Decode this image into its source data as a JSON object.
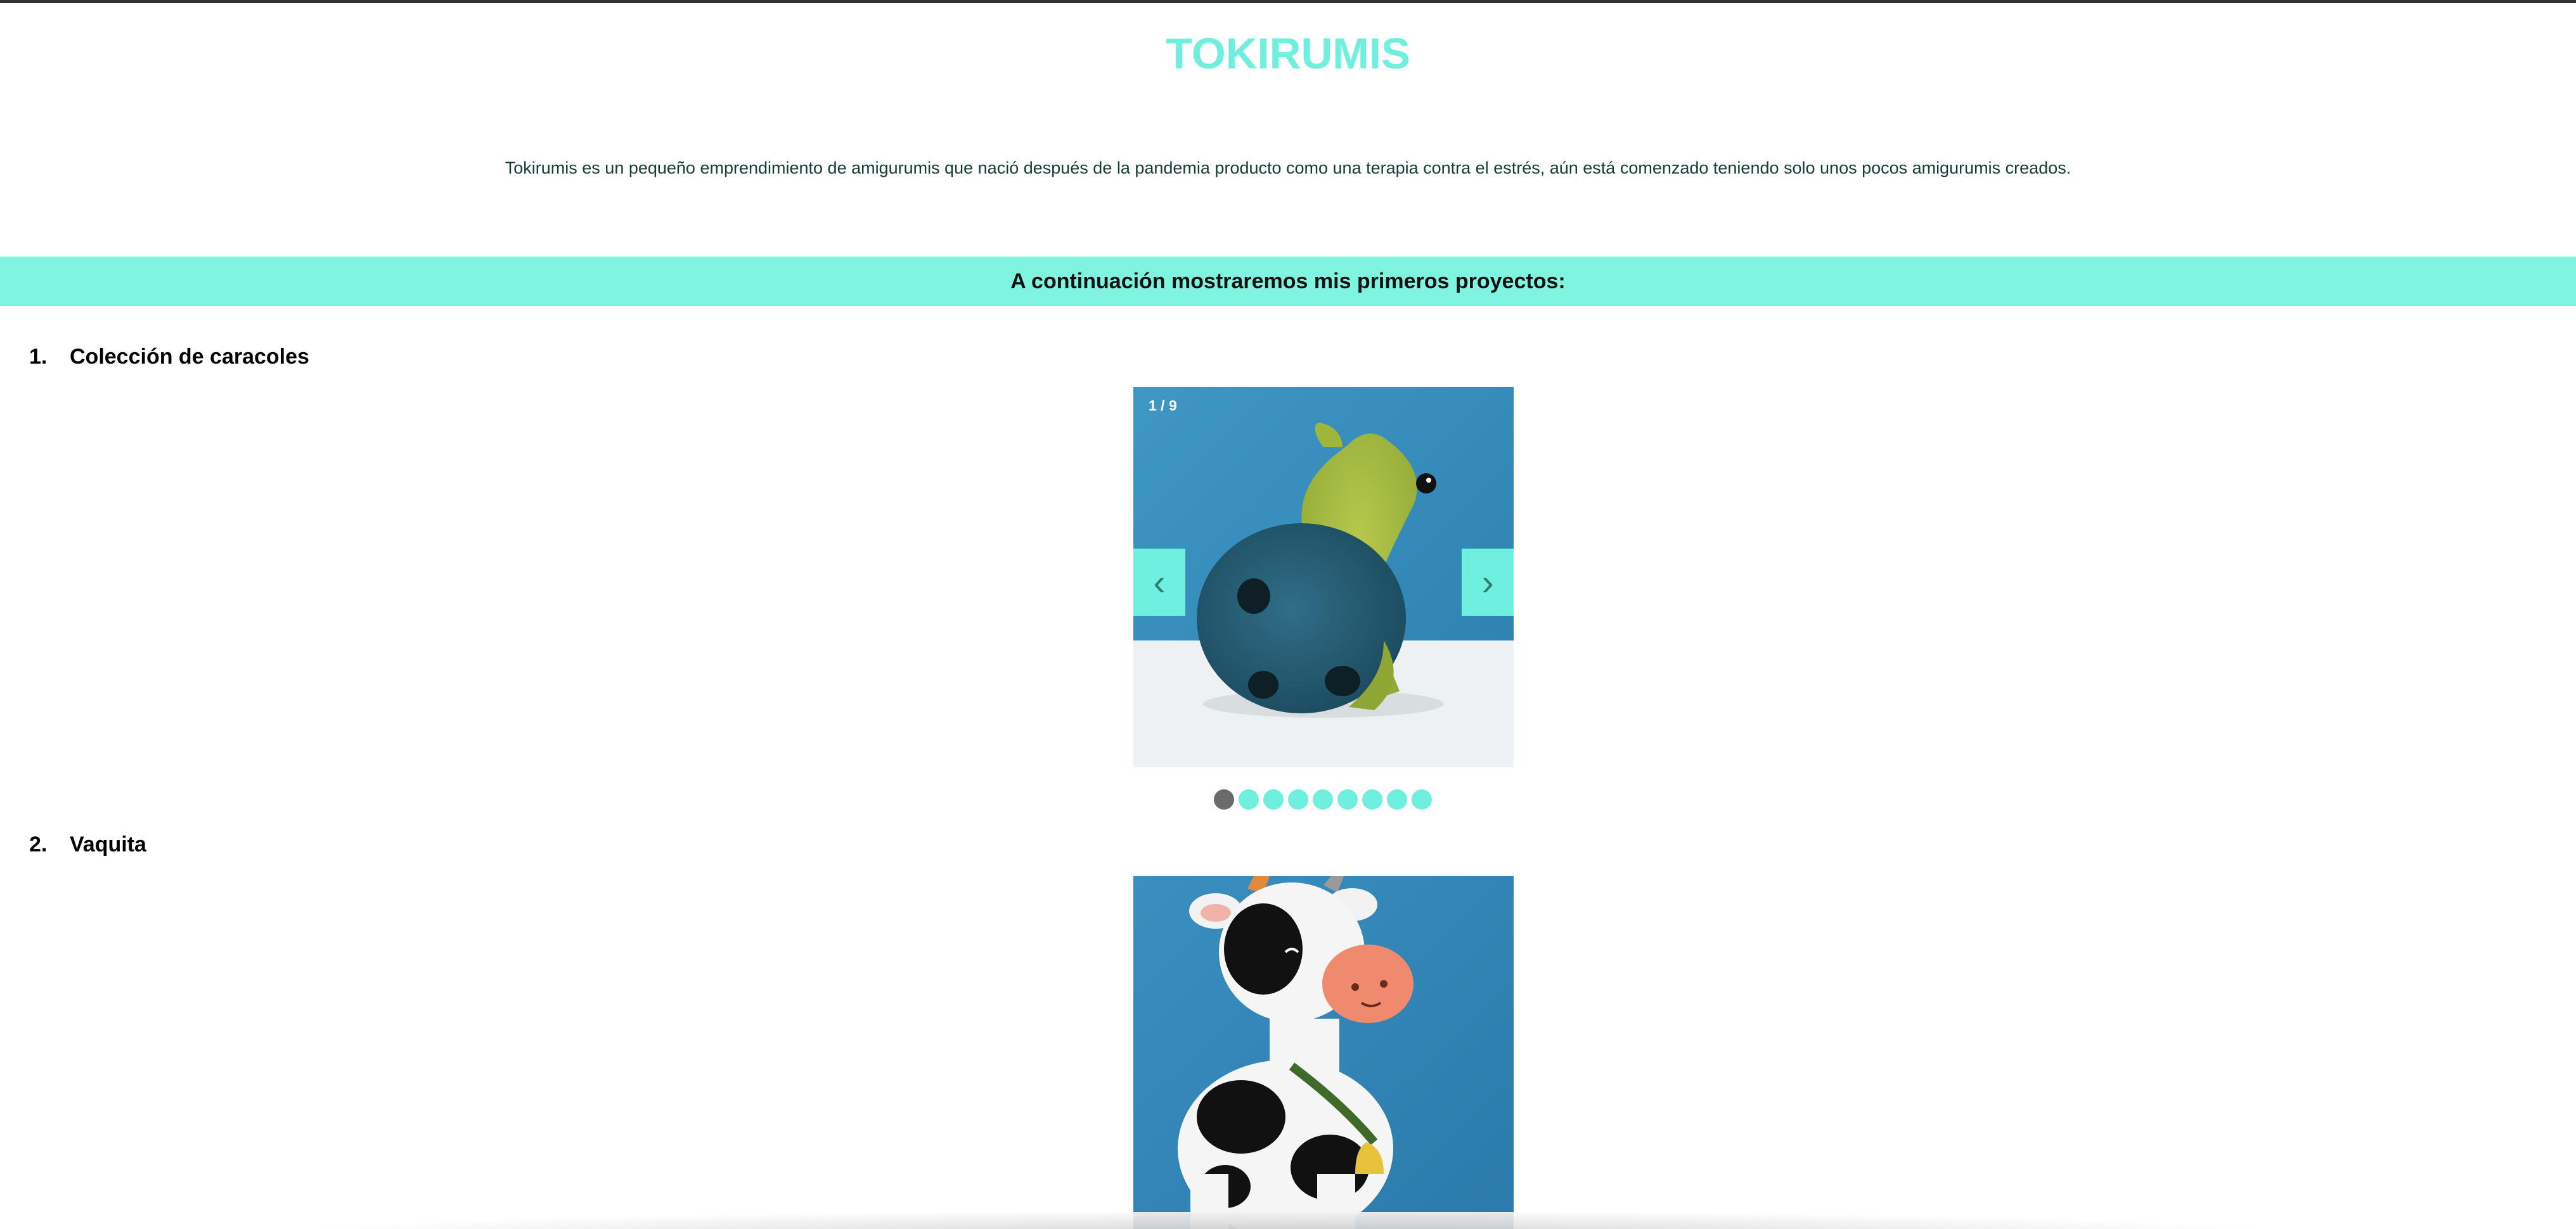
{
  "colors": {
    "accent": "#7ff5e1",
    "title": "#6ff0de",
    "nav_button": "#6ff0de",
    "dot_active": "#6b6b6b",
    "dot_inactive": "#6ff0de"
  },
  "header": {
    "title": "TOKIRUMIS",
    "intro": "Tokirumis es un pequeño emprendimiento de amigurumis que nació después de la pandemia producto como una terapia contra el estrés, aún está comenzado teniendo solo unos pocos amigurumis creados."
  },
  "banner": {
    "text": "A continuación mostraremos mis primeros proyectos:"
  },
  "projects": [
    {
      "number": "1.",
      "title": "Colección de caracoles",
      "carousel": {
        "counter": "1 / 9",
        "prev_icon": "chevron-left-icon",
        "next_icon": "chevron-right-icon",
        "prev_glyph": "‹",
        "next_glyph": "›",
        "active_index": 0,
        "total": 9,
        "image": "crochet-snail-photo"
      }
    },
    {
      "number": "2.",
      "title": "Vaquita",
      "carousel": {
        "image": "crochet-cow-photo"
      }
    }
  ]
}
